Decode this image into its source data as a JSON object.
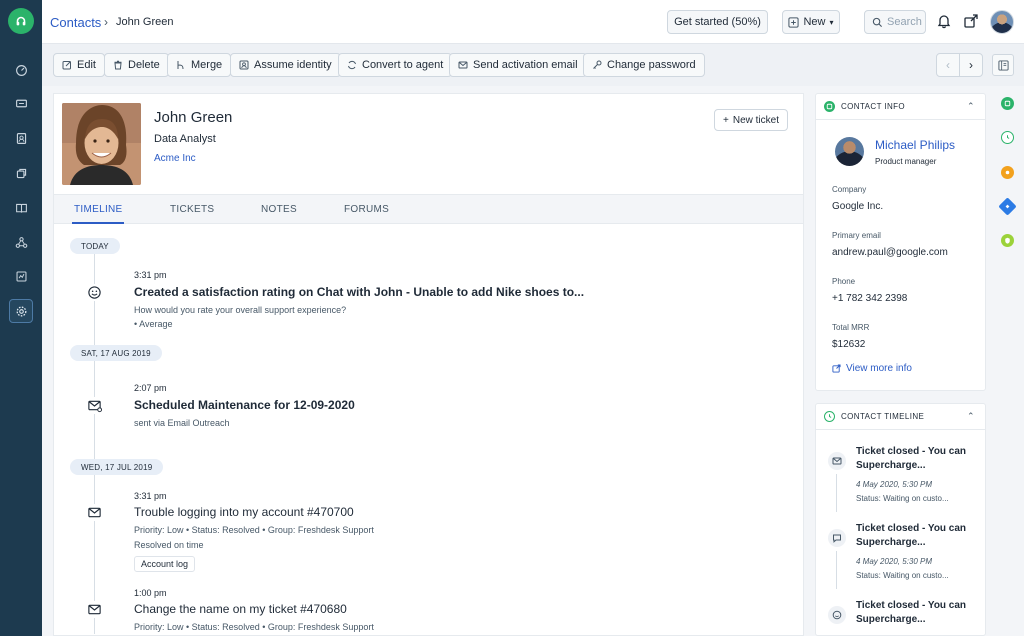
{
  "breadcrumb": {
    "root": "Contacts",
    "separator": "›",
    "current": "John Green"
  },
  "topbar": {
    "get_started": "Get started (50%)",
    "new_label": "New",
    "search_placeholder": "Search"
  },
  "actions": [
    "Edit",
    "Delete",
    "Merge",
    "Assume identity",
    "Convert to agent",
    "Send activation email",
    "Change password"
  ],
  "contact": {
    "name": "John Green",
    "title": "Data Analyst",
    "company": "Acme Inc",
    "new_ticket": "New ticket"
  },
  "tabs": [
    "TIMELINE",
    "TICKETS",
    "NOTES",
    "FORUMS"
  ],
  "timeline": {
    "days": [
      "TODAY",
      "SAT, 17 AUG 2019",
      "WED, 17 JUL 2019"
    ],
    "events": [
      {
        "time": "3:31 pm",
        "title": "Created a satisfaction rating on Chat with John - Unable to add Nike shoes to...",
        "sub1": "How would you rate your overall support experience?",
        "sub2": "• Average",
        "icon": "smiley-icon"
      },
      {
        "time": "2:07 pm",
        "title": "Scheduled Maintenance for 12-09-2020",
        "sub1": "sent via Email Outreach",
        "icon": "email-outreach-icon"
      },
      {
        "time": "3:31 pm",
        "title": "Trouble logging into my account #470700",
        "sub1": "Priority: Low  •  Status: Resolved  •  Group: Freshdesk Support",
        "sub2": "Resolved on time",
        "chip": "Account log",
        "icon": "email-icon"
      },
      {
        "time": "1:00 pm",
        "title": "Change the name on my ticket #470680",
        "sub1": "Priority: Low  •  Status: Resolved  •  Group: Freshdesk Support",
        "icon": "email-icon"
      }
    ]
  },
  "contact_info": {
    "heading": "CONTACT INFO",
    "name": "Michael Philips",
    "role": "Product manager",
    "fields": [
      {
        "label": "Company",
        "value": "Google Inc."
      },
      {
        "label": "Primary email",
        "value": "andrew.paul@google.com"
      },
      {
        "label": "Phone",
        "value": "+1 782 342 2398"
      },
      {
        "label": "Total MRR",
        "value": "$12632"
      }
    ],
    "more_link": "View more info"
  },
  "contact_timeline": {
    "heading": "CONTACT TIMELINE",
    "items": [
      {
        "title": "Ticket closed - You can Supercharge...",
        "date": "4 May 2020, 5:30 PM",
        "status": "Status: Waiting on custo...",
        "icon": "email-icon"
      },
      {
        "title": "Ticket closed - You can Supercharge...",
        "date": "4 May 2020, 5:30 PM",
        "status": "Status: Waiting on custo...",
        "icon": "chat-icon"
      },
      {
        "title": "Ticket closed - You can Supercharge...",
        "icon": "smiley-icon"
      }
    ]
  },
  "colors": {
    "accent": "#2c5cc5",
    "rail": "#1d3a4f",
    "brand_green": "#2bb36a"
  }
}
